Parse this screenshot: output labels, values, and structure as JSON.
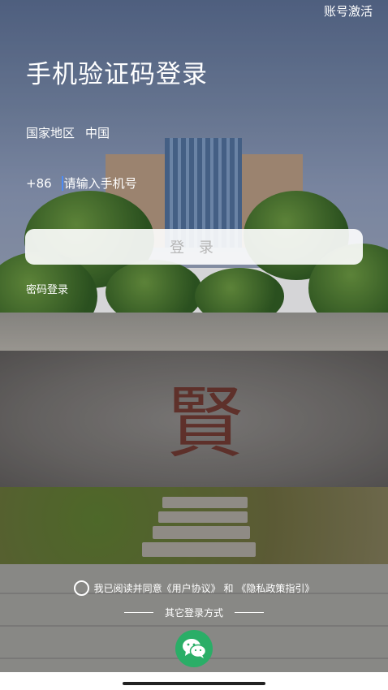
{
  "header": {
    "activate_account": "账号激活"
  },
  "title": "手机验证码登录",
  "region": {
    "label": "国家地区",
    "value": "中国"
  },
  "phone": {
    "country_code": "+86",
    "placeholder": "请输入手机号",
    "value": ""
  },
  "login_button": "登 录",
  "password_login": "密码登录",
  "agreement": {
    "prefix": "我已阅读并同意",
    "user_agreement": "《用户协议》",
    "and": "和",
    "privacy_policy": "《隐私政策指引》",
    "checked": false
  },
  "other_methods": {
    "label": "其它登录方式",
    "options": [
      "wechat-icon"
    ]
  },
  "background": {
    "engraved_character": "賢"
  },
  "colors": {
    "accent_green": "#2aae67",
    "caret_blue": "#4d8cf5",
    "button_text": "#b6b6b6"
  }
}
